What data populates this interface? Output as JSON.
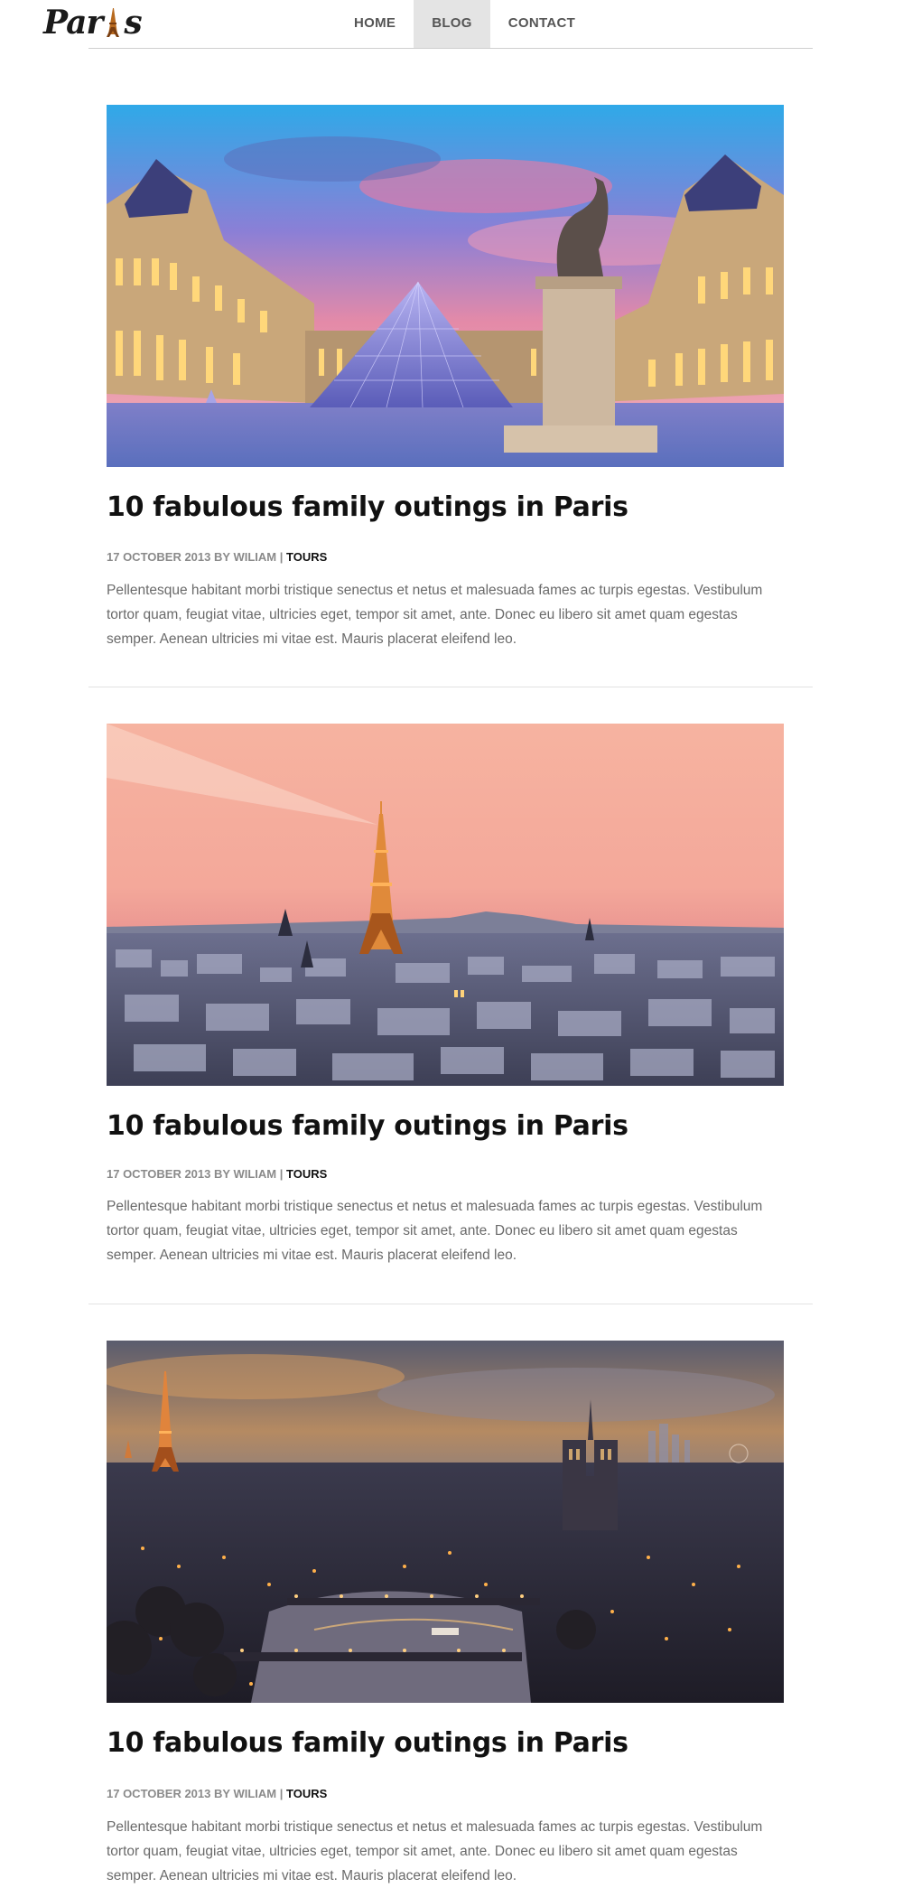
{
  "site": {
    "logo_text_left": "Par",
    "logo_text_right": "s",
    "logo_alt": "Paris"
  },
  "nav": {
    "items": [
      {
        "label": "HOME",
        "active": false
      },
      {
        "label": "BLOG",
        "active": true
      },
      {
        "label": "CONTACT",
        "active": false
      }
    ]
  },
  "posts": [
    {
      "image": "louvre-pyramid-sunset",
      "title": "10 fabulous family outings in Paris",
      "date": "17 OCTOBER 2013",
      "by": "BY",
      "author": "WILIAM",
      "separator": "|",
      "category": "TOURS",
      "excerpt": "Pellentesque habitant morbi tristique senectus et netus et malesuada fames ac turpis egestas. Vestibulum tortor quam, feugiat vitae, ultricies eget, tempor sit amet, ante. Donec eu libero sit amet quam egestas semper. Aenean ultricies mi vitae est. Mauris placerat eleifend leo."
    },
    {
      "image": "eiffel-tower-skyline-dusk",
      "title": "10 fabulous family outings in Paris",
      "date": "17 OCTOBER 2013",
      "by": "BY",
      "author": "WILIAM",
      "separator": "|",
      "category": "TOURS",
      "excerpt": "Pellentesque habitant morbi tristique senectus et netus et malesuada fames ac turpis egestas. Vestibulum tortor quam, feugiat vitae, ultricies eget, tempor sit amet, ante. Donec eu libero sit amet quam egestas semper. Aenean ultricies mi vitae est. Mauris placerat eleifend leo."
    },
    {
      "image": "notre-dame-seine-night",
      "title": "10 fabulous family outings in Paris",
      "date": "17 OCTOBER 2013",
      "by": "BY",
      "author": "WILIAM",
      "separator": "|",
      "category": "TOURS",
      "excerpt": "Pellentesque habitant morbi tristique senectus et netus et malesuada fames ac turpis egestas. Vestibulum tortor quam, feugiat vitae, ultricies eget, tempor sit amet, ante. Donec eu libero sit amet quam egestas semper. Aenean ultricies mi vitae est. Mauris placerat eleifend leo."
    }
  ]
}
